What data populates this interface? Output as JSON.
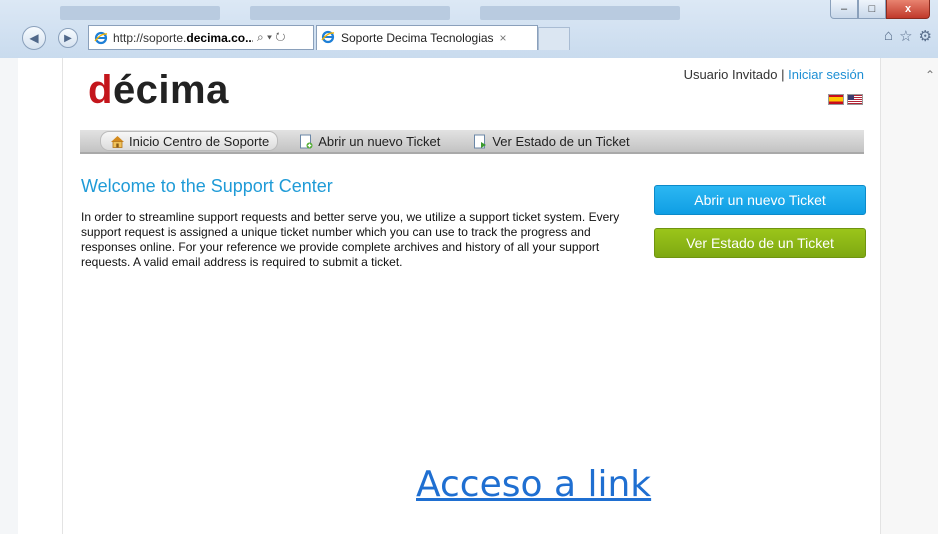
{
  "browser": {
    "url_prefix": "http://soporte.",
    "url_domain": "decima.co...",
    "url_controls": "⌕ ▾ ↻",
    "active_tab_title": "Soporte Decima Tecnologias",
    "tab_close": "×",
    "window_buttons": {
      "minimize": "–",
      "maximize": "□",
      "close": "x"
    },
    "toolbar_icons": [
      "home-icon",
      "star-icon",
      "gear-icon"
    ]
  },
  "header": {
    "logo_prefix": "d",
    "logo_rest": "écima",
    "guest_text": "Usuario Invitado |",
    "login_link": "Iniciar sesión",
    "flags": [
      "es-flag",
      "us-flag"
    ]
  },
  "nav": {
    "items": [
      {
        "label": "Inicio Centro de Soporte",
        "icon": "home-icon"
      },
      {
        "label": "Abrir un nuevo Ticket",
        "icon": "new-ticket-icon"
      },
      {
        "label": "Ver Estado de un Ticket",
        "icon": "ticket-status-icon"
      }
    ]
  },
  "main": {
    "title": "Welcome to the Support Center",
    "intro": "In order to streamline support requests and better serve you, we utilize a support ticket system. Every support request is assigned a unique ticket number which you can use to track the progress and responses online. For your reference we provide complete archives and history of all your support requests. A valid email address is required to submit a ticket.",
    "open_ticket_button": "Abrir un nuevo Ticket",
    "check_status_button": "Ver Estado de un Ticket"
  },
  "overlay": {
    "access_link": "Acceso a link"
  },
  "colors": {
    "accent_blue": "#1f9bd7",
    "open_button": "#1aa8ec",
    "status_button": "#8cb616",
    "logo_red": "#c4161c"
  }
}
